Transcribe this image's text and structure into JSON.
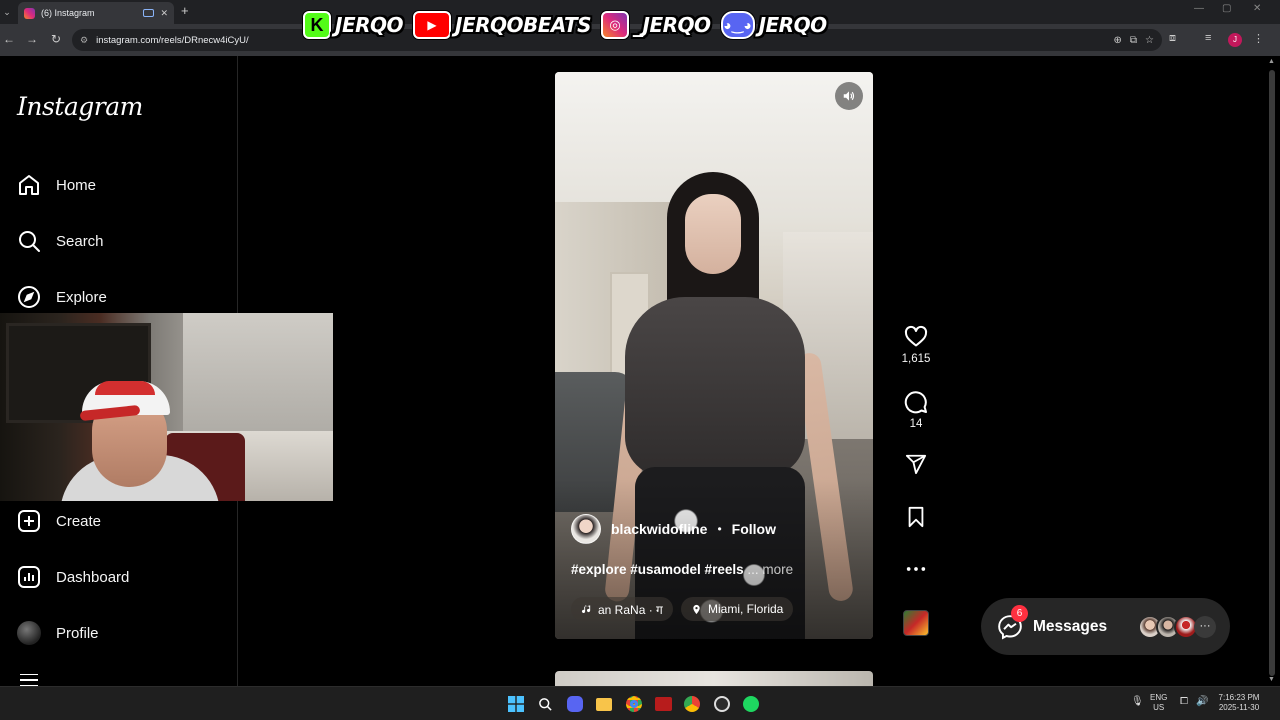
{
  "browser": {
    "tab_title": "(6) Instagram",
    "url": "instagram.com/reels/DRnecw4iCyU/",
    "profile_initial": "J"
  },
  "stream_banner": {
    "kick_handle": "JERQO",
    "youtube_handle": "JERQOBEATS",
    "instagram_handle": "_JERQO",
    "discord_handle": "JERQO"
  },
  "sidebar": {
    "logo": "Instagram",
    "items": [
      {
        "label": "Home",
        "icon": "home-icon"
      },
      {
        "label": "Search",
        "icon": "search-icon"
      },
      {
        "label": "Explore",
        "icon": "compass-icon"
      },
      {
        "label": "Create",
        "icon": "plus-square-icon"
      },
      {
        "label": "Dashboard",
        "icon": "chart-icon"
      },
      {
        "label": "Profile",
        "icon": "avatar"
      }
    ]
  },
  "reel": {
    "username": "blackwidofline",
    "separator": "•",
    "follow_label": "Follow",
    "caption": "#explore #usamodel #reels",
    "caption_more": "... more",
    "audio": "an RaNa · ग",
    "location": "Miami, Florida"
  },
  "actions": {
    "likes": "1,615",
    "comments": "14"
  },
  "messages": {
    "label": "Messages",
    "badge": "6"
  },
  "taskbar": {
    "language_top": "ENG",
    "language_bottom": "US",
    "time": "7:16:23 PM",
    "date": "2025-11-30"
  },
  "colors": {
    "background": "#000000",
    "chrome_dark": "#202124",
    "chrome_toolbar": "#35363a",
    "notification_red": "#ff3040",
    "messages_pill": "#262626"
  }
}
